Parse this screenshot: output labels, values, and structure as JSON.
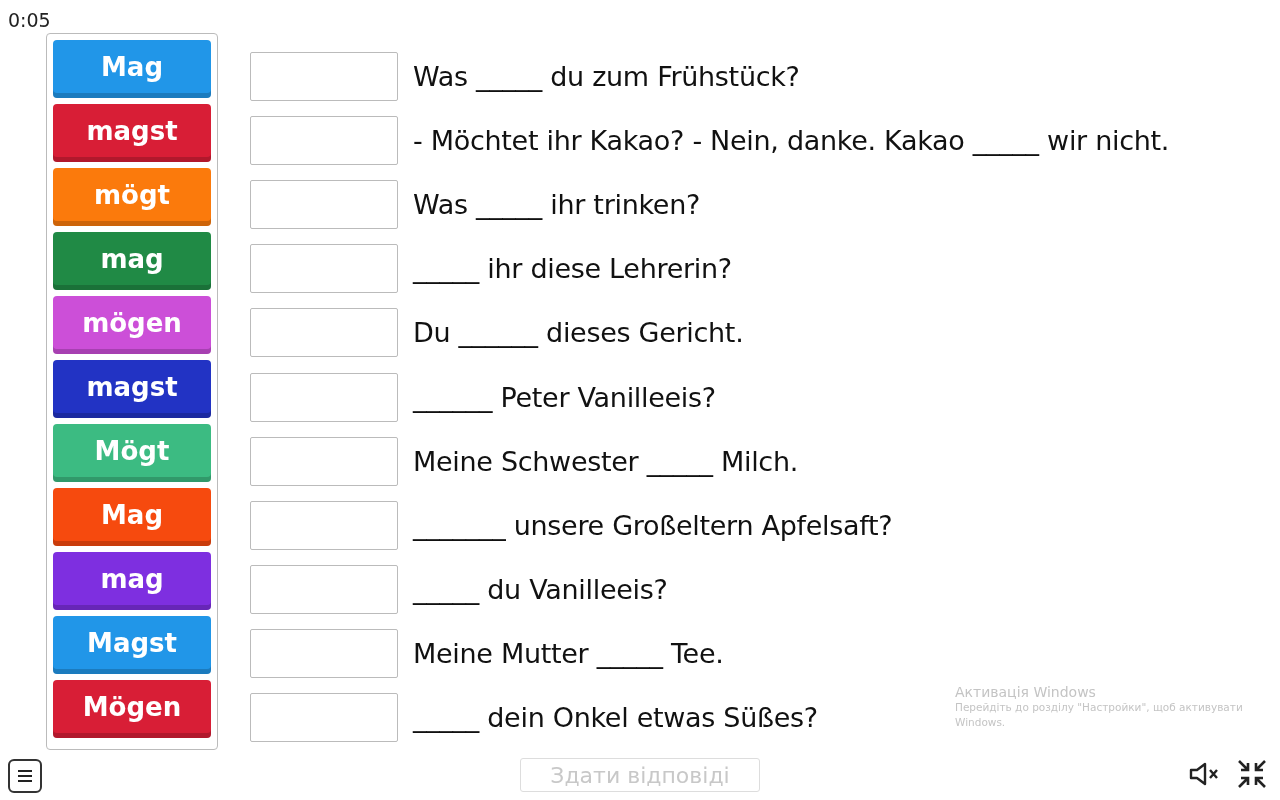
{
  "timer": "0:05",
  "tiles": [
    {
      "label": "Mag",
      "color": "#2196e8"
    },
    {
      "label": "magst",
      "color": "#d81e36"
    },
    {
      "label": "mögt",
      "color": "#fb7a0c"
    },
    {
      "label": "mag",
      "color": "#208a45"
    },
    {
      "label": "mögen",
      "color": "#cc4fd8"
    },
    {
      "label": "magst",
      "color": "#2233c4"
    },
    {
      "label": "Mögt",
      "color": "#3cbb82"
    },
    {
      "label": "Mag",
      "color": "#f64a0e"
    },
    {
      "label": "mag",
      "color": "#7e2fe0"
    },
    {
      "label": "Magst",
      "color": "#2196e8"
    },
    {
      "label": "Mögen",
      "color": "#d81e36"
    }
  ],
  "sentences": [
    "Was _____ du zum Frühstück?",
    "- Möchtet ihr Kakao? - Nein, danke. Kakao _____ wir nicht.",
    "Was _____ ihr trinken?",
    "_____ ihr diese Lehrerin?",
    "Du ______ dieses Gericht.",
    "______ Peter Vanilleeis?",
    "Meine Schwester _____ Milch.",
    "_______ unsere Großeltern Apfelsaft?",
    "_____ du Vanilleeis?",
    "Meine Mutter _____ Tee.",
    "_____ dein Onkel etwas Süßes?"
  ],
  "activation": {
    "title": "Активація Windows",
    "text": "Перейдіть до розділу \"Настройки\", щоб активувати Windows."
  },
  "submit": {
    "label": "Здати відповіді",
    "disabled": true
  }
}
